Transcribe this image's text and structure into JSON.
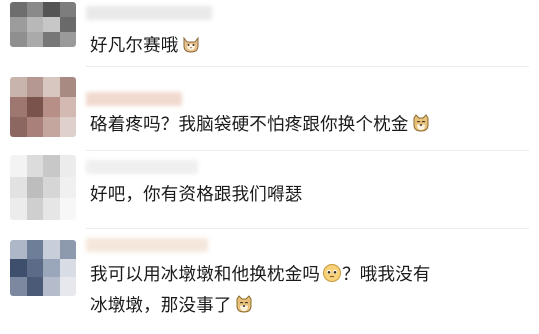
{
  "comments": [
    {
      "text": "好凡尔赛哦",
      "emoji": "cat-face-icon"
    },
    {
      "text": "硌着疼吗？我脑袋硬不怕疼跟你换个枕金",
      "emoji": "doge-icon"
    },
    {
      "text": "好吧，你有资格跟我们嘚瑟",
      "emoji": ""
    },
    {
      "line1_a": "我可以用冰墩墩和他换枕金吗",
      "line1_emoji": "pleading-face-icon",
      "line1_b": "？哦我没有",
      "line2": "冰墩墩，那没事了",
      "line2_emoji": "doge-icon"
    }
  ]
}
